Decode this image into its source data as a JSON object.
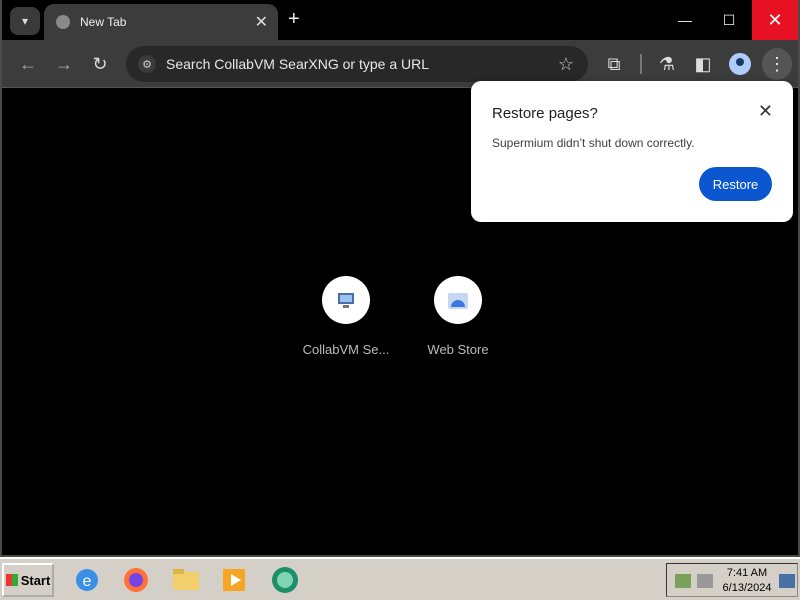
{
  "browser": {
    "tab_title": "New Tab",
    "omnibox_placeholder": "Search CollabVM SearXNG or type a URL"
  },
  "popup": {
    "title": "Restore pages?",
    "message": "Supermium didn’t shut down correctly.",
    "button": "Restore"
  },
  "shortcuts": [
    {
      "label": "CollabVM Se...",
      "icon": "collabvm-icon"
    },
    {
      "label": "Web Store",
      "icon": "web-store-icon"
    }
  ],
  "taskbar": {
    "start_label": "Start",
    "time": "7:41 AM",
    "date": "6/13/2024"
  },
  "colors": {
    "accent": "#0b57d0",
    "close_red": "#e81123"
  }
}
